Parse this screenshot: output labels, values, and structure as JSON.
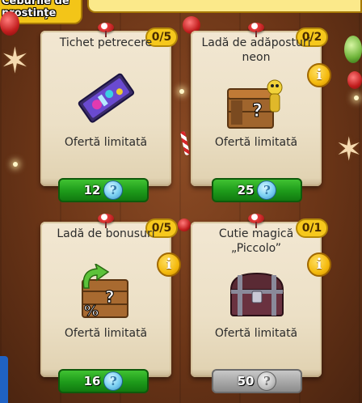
{
  "header": {
    "tab_label": "Ceburile de\nprostințe"
  },
  "cards": [
    {
      "title": "Tichet petrecere",
      "counter": "0/5",
      "offer": "Ofertă limitată",
      "price": "12",
      "price_state": "available",
      "has_info": false,
      "icon": "party-ticket-icon"
    },
    {
      "title": "Ladă de adăposturi\nneon",
      "counter": "0/2",
      "offer": "Ofertă limitată",
      "price": "25",
      "price_state": "available",
      "has_info": true,
      "icon": "neon-shelter-chest-icon"
    },
    {
      "title": "Ladă de bonusuri",
      "counter": "0/5",
      "offer": "Ofertă limitată",
      "price": "16",
      "price_state": "available",
      "has_info": true,
      "icon": "bonus-chest-icon"
    },
    {
      "title": "Cutie magică\n„Piccolo”",
      "counter": "0/1",
      "offer": "Ofertă limitată",
      "price": "50",
      "price_state": "disabled",
      "has_info": true,
      "icon": "magic-box-icon"
    }
  ],
  "currency_icon": "crystal-coin-icon",
  "colors": {
    "price_green": "#1d9a1a",
    "price_gray": "#a6a6a6",
    "counter_yellow": "#f6c81c",
    "info_yellow": "#f4b90c"
  }
}
